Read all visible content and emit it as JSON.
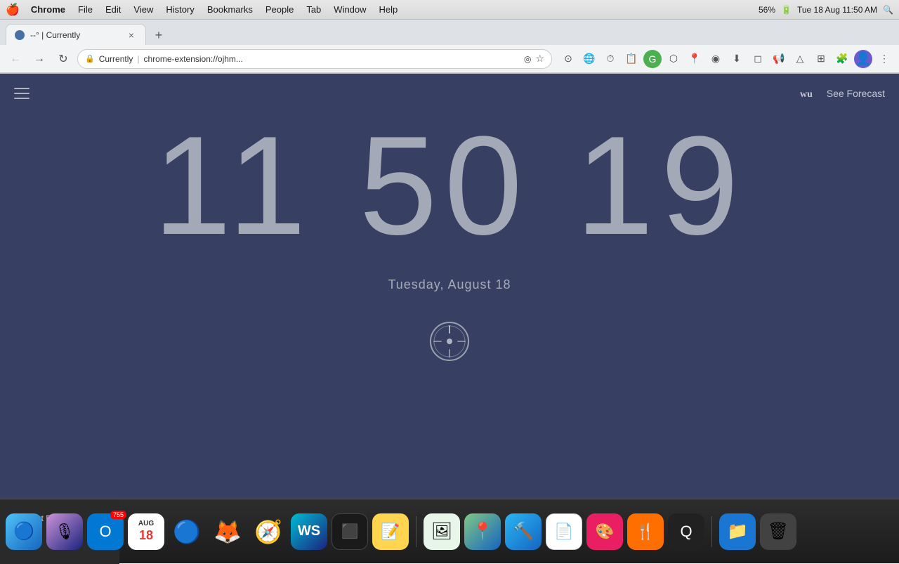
{
  "menubar": {
    "apple": "🍎",
    "items": [
      "Chrome",
      "File",
      "Edit",
      "View",
      "History",
      "Bookmarks",
      "People",
      "Tab",
      "Window",
      "Help"
    ],
    "battery": "56%",
    "datetime": "Tue 18 Aug  11:50 AM"
  },
  "tab": {
    "title": "--° | Currently",
    "close": "×"
  },
  "addressbar": {
    "extension_label": "Currently",
    "url": "chrome-extension://ojhm...",
    "bookmark_icon": "★"
  },
  "extension": {
    "clock": "11 50 19",
    "date": "Tuesday, August 18",
    "forecast_label": "See Forecast",
    "menu_label": "Menu"
  },
  "dock": {
    "separator_label": "|",
    "sidebar_folder": "Smart Folders"
  },
  "colors": {
    "bg": "#374063",
    "clock_text": "rgba(255,255,255,0.55)"
  }
}
